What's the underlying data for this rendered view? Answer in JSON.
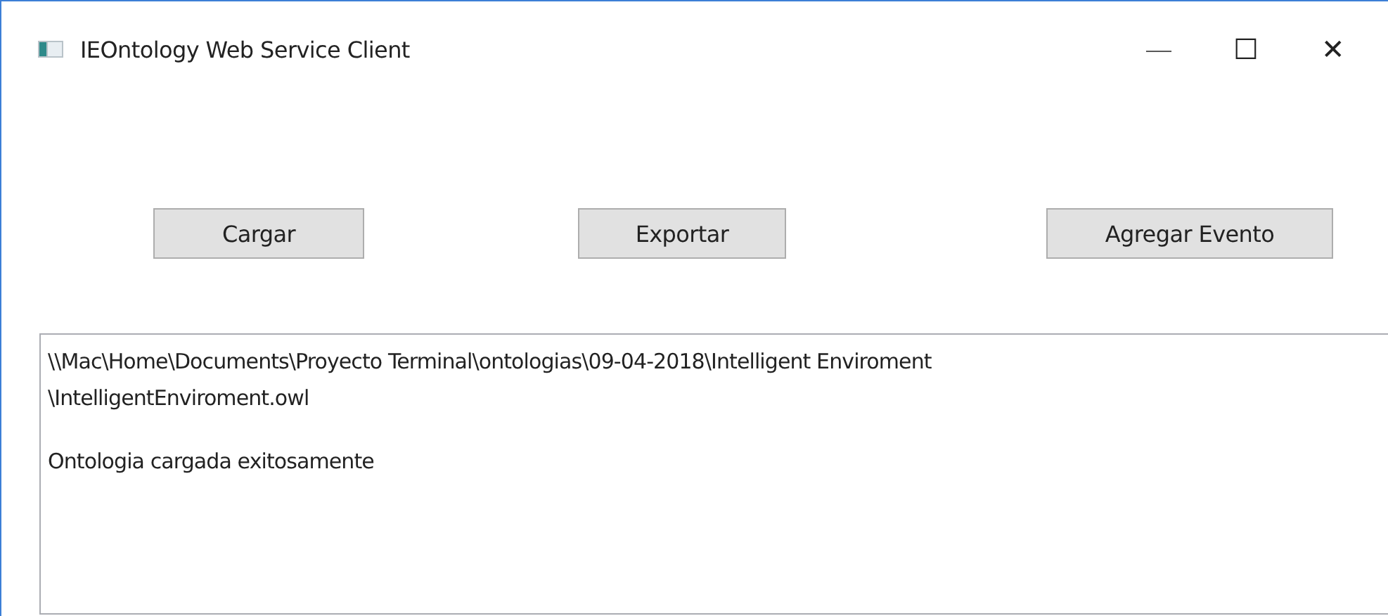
{
  "window": {
    "title": "IEOntology Web Service Client",
    "controls": [
      "—",
      "☐",
      "✕"
    ]
  },
  "buttons": [
    {
      "label": "Cargar"
    },
    {
      "label": "Exportar"
    },
    {
      "label": "Agregar Evento"
    }
  ],
  "output": {
    "paragraphs": [
      {
        "lines": [
          "\\\\Mac\\Home\\Documents\\Proyecto Terminal\\ontologias\\09-04-2018\\Intelligent Enviroment",
          "\\IntelligentEnviroment.owl"
        ]
      },
      {
        "lines": [
          "Ontologia cargada exitosamente"
        ]
      }
    ]
  }
}
